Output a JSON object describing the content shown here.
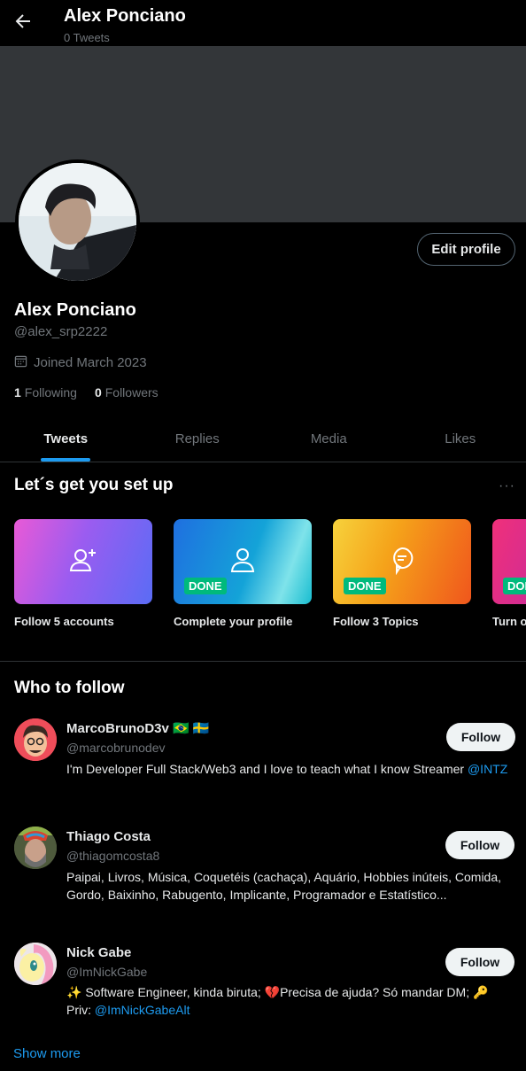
{
  "header": {
    "title": "Alex Ponciano",
    "subtitle": "0 Tweets"
  },
  "profile": {
    "edit_label": "Edit profile",
    "name": "Alex Ponciano",
    "handle": "@alex_srp2222",
    "joined": "Joined March 2023",
    "following_count": "1",
    "following_label": "Following",
    "followers_count": "0",
    "followers_label": "Followers"
  },
  "tabs": [
    {
      "label": "Tweets",
      "active": true
    },
    {
      "label": "Replies"
    },
    {
      "label": "Media"
    },
    {
      "label": "Likes"
    }
  ],
  "setup": {
    "title": "Let´s get you set up",
    "more": "···",
    "cards": [
      {
        "label": "Follow 5 accounts",
        "icon": "add-user-icon",
        "done": ""
      },
      {
        "label": "Complete your profile",
        "icon": "user-icon",
        "done": "DONE"
      },
      {
        "label": "Follow 3 Topics",
        "icon": "speech-bubble-icon",
        "done": "DONE"
      },
      {
        "label": "Turn o",
        "icon": "",
        "done": "DON"
      }
    ]
  },
  "who_to_follow": {
    "title": "Who to follow",
    "follow_label": "Follow",
    "users": [
      {
        "name": "MarcoBrunoD3v 🇧🇷 🇸🇪",
        "handle": "@marcobrunodev",
        "bio": "I'm Developer Full Stack/Web3 and I love to teach what I know Streamer ",
        "bio_link": "@INTZ"
      },
      {
        "name": "Thiago Costa",
        "handle": "@thiagomcosta8",
        "bio": "Paipai, Livros, Música, Coquetéis (cachaça), Aquário, Hobbies inúteis, Comida, Gordo, Baixinho, Rabugento, Implicante, Programador e Estatístico..."
      },
      {
        "name": "Nick Gabe",
        "handle": "@ImNickGabe",
        "bio": "✨ Software Engineer, kinda biruta; 💔Precisa de ajuda? Só mandar DM; 🔑 Priv: ",
        "bio_link": "@ImNickGabeAlt"
      }
    ],
    "show_more": "Show more"
  },
  "colors": {
    "accent": "#1d9bf0",
    "done_badge": "#00ba7c",
    "banner": "#333639"
  }
}
